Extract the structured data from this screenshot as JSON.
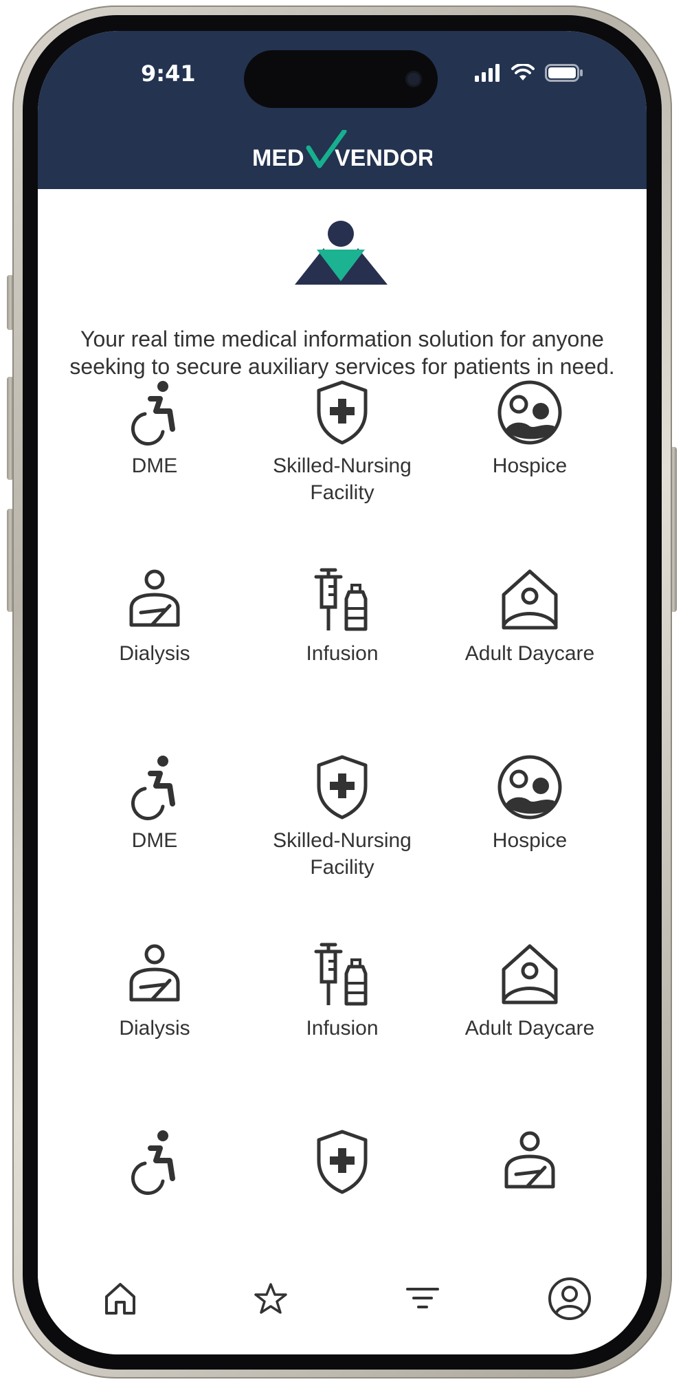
{
  "status_bar": {
    "time": "9:41"
  },
  "header": {
    "logo_text_left": "MED",
    "logo_text_right": "VENDOR",
    "brand_bg": "#233350",
    "accent": "#17b08f"
  },
  "intro": {
    "tagline_line1": "Your real time medical information solution for anyone",
    "tagline_line2": "seeking to secure auxiliary services for patients in need."
  },
  "categories": [
    {
      "label": "DME",
      "icon": "wheelchair-icon"
    },
    {
      "label": "Skilled-Nursing Facility",
      "icon": "shield-plus-icon"
    },
    {
      "label": "Hospice",
      "icon": "hospice-face-icon"
    },
    {
      "label": "Dialysis",
      "icon": "patient-arm-sling-icon"
    },
    {
      "label": "Infusion",
      "icon": "syringe-vial-icon"
    },
    {
      "label": "Adult Daycare",
      "icon": "house-person-icon"
    },
    {
      "label": "DME",
      "icon": "wheelchair-icon"
    },
    {
      "label": "Skilled-Nursing Facility",
      "icon": "shield-plus-icon"
    },
    {
      "label": "Hospice",
      "icon": "hospice-face-icon"
    },
    {
      "label": "Dialysis",
      "icon": "patient-arm-sling-icon"
    },
    {
      "label": "Infusion",
      "icon": "syringe-vial-icon"
    },
    {
      "label": "Adult Daycare",
      "icon": "house-person-icon"
    },
    {
      "label": "",
      "icon": "wheelchair-icon"
    },
    {
      "label": "",
      "icon": "shield-plus-icon"
    },
    {
      "label": "",
      "icon": "patient-arm-sling-icon"
    }
  ],
  "tab_bar": {
    "items": [
      {
        "icon": "home-icon"
      },
      {
        "icon": "star-icon"
      },
      {
        "icon": "filter-icon"
      },
      {
        "icon": "profile-icon"
      }
    ]
  }
}
